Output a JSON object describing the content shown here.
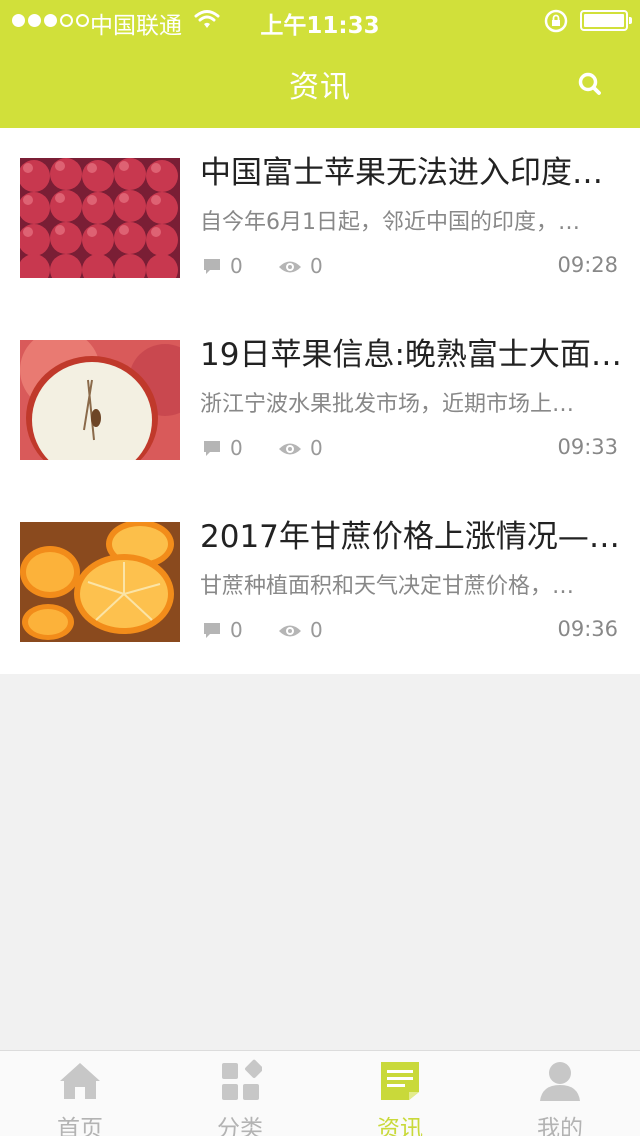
{
  "status_bar": {
    "carrier": "中国联通",
    "time": "上午11:33"
  },
  "header": {
    "title": "资讯",
    "search_icon": "search-icon"
  },
  "news": [
    {
      "title": "中国富士苹果无法进入印度…",
      "summary": "自今年6月1日起，邻近中国的印度，…",
      "comments": "0",
      "views": "0",
      "time": "09:28",
      "image": "red-apples-photo"
    },
    {
      "title": "19日苹果信息:晚熟富士大面…",
      "summary": "浙江宁波水果批发市场，近期市场上…",
      "comments": "0",
      "views": "0",
      "time": "09:33",
      "image": "cut-apple-photo"
    },
    {
      "title": "2017年甘蔗价格上涨情况—…",
      "summary": "甘蔗种植面积和天气决定甘蔗价格，…",
      "comments": "0",
      "views": "0",
      "time": "09:36",
      "image": "orange-slices-photo"
    }
  ],
  "tabbar": {
    "tabs": [
      {
        "label": "首页",
        "icon": "home-icon",
        "active": false
      },
      {
        "label": "分类",
        "icon": "category-icon",
        "active": false
      },
      {
        "label": "资讯",
        "icon": "news-icon",
        "active": true
      },
      {
        "label": "我的",
        "icon": "user-icon",
        "active": false
      }
    ]
  },
  "colors": {
    "accent": "#d1e03a",
    "background": "#f1f1f1",
    "tab_inactive": "#b3b3b3"
  }
}
